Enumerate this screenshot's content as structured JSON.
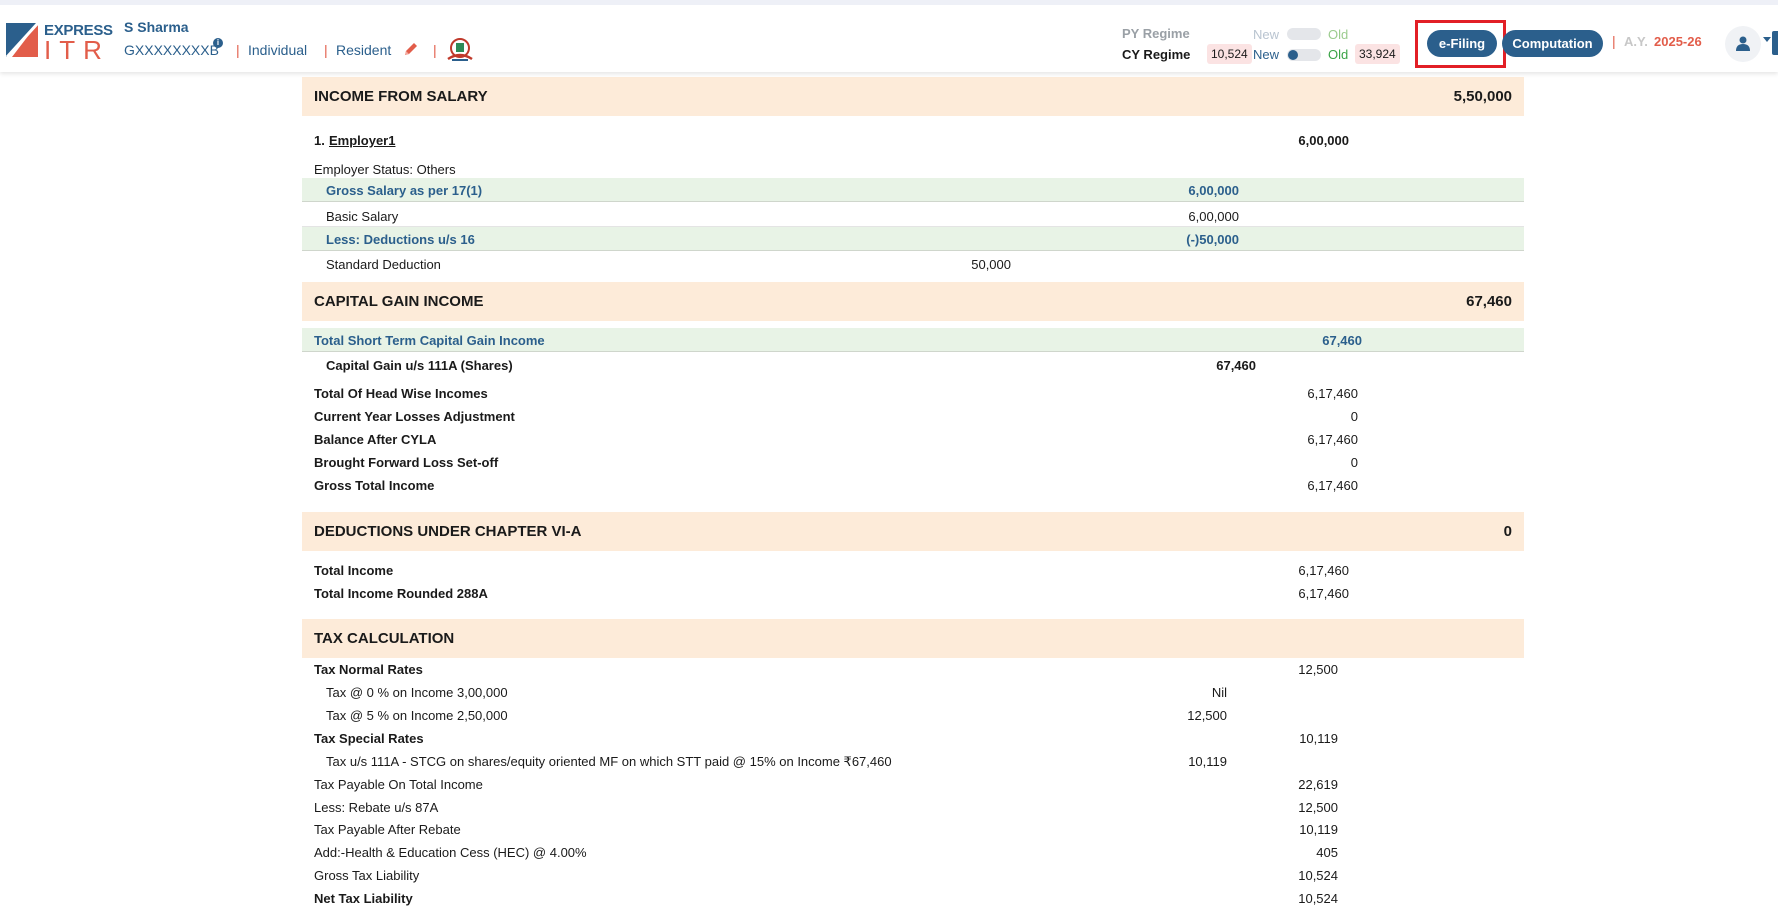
{
  "header": {
    "logo_express": "EXPRESS",
    "logo_itr": "ITR",
    "user_name": "S Sharma",
    "pan": "GXXXXXXXXB",
    "status": "Individual",
    "residency": "Resident",
    "py_regime_label": "PY Regime",
    "cy_regime_label": "CY Regime",
    "py_new": "New",
    "py_old": "Old",
    "cy_new": "New",
    "cy_old": "Old",
    "cy_new_tax": "10,524",
    "cy_old_tax": "33,924",
    "efiling_label": "e-Filing",
    "computation_label": "Computation",
    "ay_label": "A.Y.",
    "ay_value": "2025-26"
  },
  "colors": {
    "brand_blue": "#2b5f8c",
    "brand_red": "#e25d4a",
    "section_bg": "#fdebd9",
    "subtotal_bg": "#e8f3e6",
    "highlight_outline": "#e21f26"
  },
  "salary": {
    "title": "INCOME FROM SALARY",
    "total": "5,50,000",
    "employer_prefix": "1.",
    "employer_name": "Employer1",
    "employer_amount": "6,00,000",
    "employer_status": "Employer Status: Others",
    "gross_label": "Gross Salary as per 17(1)",
    "gross_value": "6,00,000",
    "basic_label": "Basic Salary",
    "basic_value": "6,00,000",
    "deductions_label": "Less: Deductions u/s 16",
    "deductions_value": "(-)50,000",
    "standard_label": "Standard Deduction",
    "standard_value": "50,000"
  },
  "capital_gain": {
    "title": "CAPITAL GAIN INCOME",
    "total": "67,460",
    "stcg_label": "Total Short Term Capital Gain Income",
    "stcg_value": "67,460",
    "sec111a_label": "Capital Gain u/s 111A (Shares)",
    "sec111a_value": "67,460"
  },
  "summary": [
    {
      "label": "Total Of Head Wise Incomes",
      "value": "6,17,460"
    },
    {
      "label": "Current Year Losses Adjustment",
      "value": "0"
    },
    {
      "label": "Balance After CYLA",
      "value": "6,17,460"
    },
    {
      "label": "Brought Forward Loss Set-off",
      "value": "0"
    },
    {
      "label": "Gross Total Income",
      "value": "6,17,460"
    }
  ],
  "deductions": {
    "title": "DEDUCTIONS UNDER CHAPTER VI-A",
    "total": "0",
    "total_income_label": "Total Income",
    "total_income_value": "6,17,460",
    "rounded_label": "Total Income Rounded 288A",
    "rounded_value": "6,17,460"
  },
  "tax": {
    "title": "TAX CALCULATION",
    "normal_label": "Tax Normal Rates",
    "normal_value": "12,500",
    "slab1_label": "Tax @ 0 % on Income 3,00,000",
    "slab1_value": "Nil",
    "slab2_label": "Tax @ 5 % on Income 2,50,000",
    "slab2_value": "12,500",
    "special_label": "Tax Special Rates",
    "special_value": "10,119",
    "stcg_label": "Tax u/s 111A - STCG on shares/equity oriented MF on which STT paid @ 15% on Income ₹67,460",
    "stcg_value": "10,119",
    "lines": [
      {
        "label": "Tax Payable On Total Income",
        "value": "22,619"
      },
      {
        "label": "Less: Rebate u/s 87A",
        "value": "12,500"
      },
      {
        "label": "Tax Payable After Rebate",
        "value": "10,119"
      },
      {
        "label": "Add:-Health & Education Cess (HEC) @ 4.00%",
        "value": "405"
      },
      {
        "label": "Gross Tax Liability",
        "value": "10,524"
      }
    ],
    "net_label": "Net Tax Liability",
    "net_value": "10,524"
  }
}
